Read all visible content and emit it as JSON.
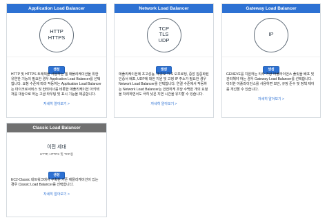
{
  "cards": [
    {
      "title": "Application Load Balancer",
      "protocols": [
        "HTTP",
        "HTTPS"
      ],
      "button": "생성",
      "description": "HTTP 및 HTTPS 트래픽을 사용하는 웹 애플리케이션을 위한 유연한 기능이 필요한 경우 Application Load Balancer를 선택합니다. 요청 수준에 따라 작동하는 Application Load Balancer는 마이크로서비스 및 컨테이너를 비롯한 애플리케이션 아키텍처를 대상으로 하는 고급 라우팅 및 표시 기능을 제공합니다.",
      "more": "자세히 알아보기 >"
    },
    {
      "title": "Network Load Balancer",
      "protocols": [
        "TCP",
        "TLS",
        "UDP"
      ],
      "button": "생성",
      "description": "애플리케이션에 초고성능, 대규모 TLS 오프로딩, 중앙 집중화된 인증서 배포, UDP에 대한 지원 및 고정 IP 주소가 필요한 경우 Network Load Balancer를 선택합니다. 연결 수준에서 작동하는 Network Load Balancer는 안전하게 초당 수백만 개의 요청을 처리하면서도 극히 낮은 지연 시간을 유지할 수 있습니다.",
      "more": "자세히 알아보기 >"
    },
    {
      "title": "Gateway Load Balancer",
      "protocols": [
        "IP"
      ],
      "button": "생성",
      "description": "GENEVE를 지원하는 타사 가상 어플라이언스 플릿을 배포 및 관리해야 하는 경우 Gateway Load Balancer를 선택합니다. 이러한 어플라이언스를 사용하면 보안, 규정 준수 및 정책 제어를 개선할 수 있습니다.",
      "more": "자세히 알아보기 >"
    },
    {
      "title": "Classic Load Balancer",
      "generation": "이전 세대",
      "generation_sub": "HTTP, HTTPS 및 TCP용",
      "button": "생성",
      "description": "EC2-Classic 네트워크에서 구축된 기존 애플리케이션이 있는 경우 Classic Load Balancer를 선택합니다.",
      "more": "자세히 알아보기 >"
    }
  ],
  "colors": {
    "header_blue": "#2d71d3",
    "header_gray": "#707070",
    "link": "#2d71d3"
  }
}
